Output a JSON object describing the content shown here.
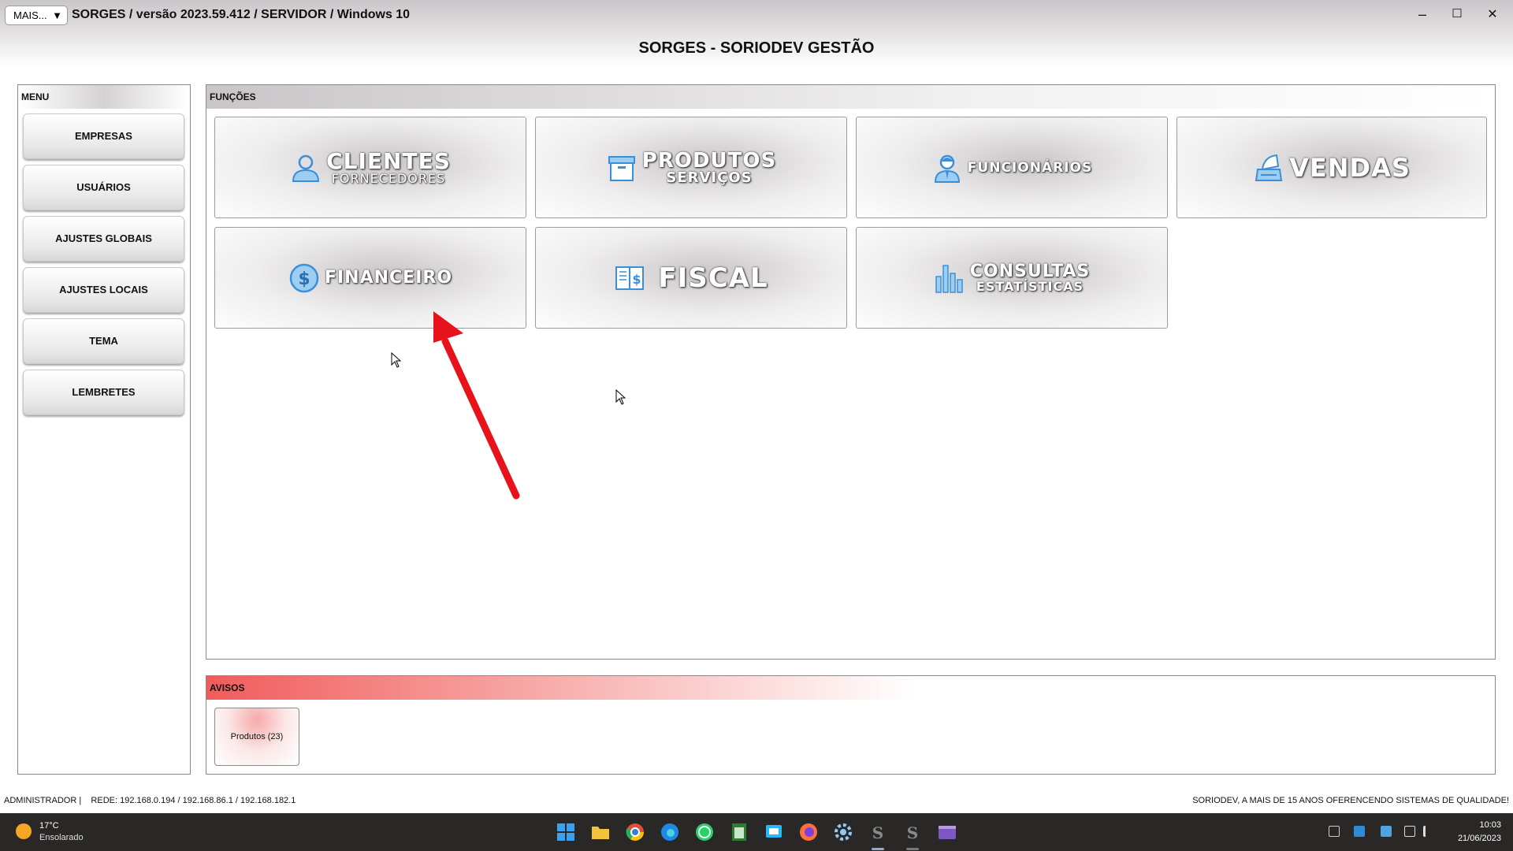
{
  "window": {
    "mais_label": "MAIS...",
    "mais_caret": "▼",
    "title": "SORGES / versão 2023.59.412 / SERVIDOR / Windows 10",
    "minimize_glyph": "–",
    "maximize_glyph": "☐",
    "close_glyph": "✕"
  },
  "app_title": "SORGES - SORIODEV GESTÃO",
  "menu": {
    "header": "MENU",
    "items": [
      "EMPRESAS",
      "USUÁRIOS",
      "AJUSTES GLOBAIS",
      "AJUSTES LOCAIS",
      "TEMA",
      "LEMBRETES"
    ]
  },
  "funcoes": {
    "header": "FUNÇÕES",
    "tiles": [
      {
        "main": "CLIENTES",
        "sub": "FORNECEDORES",
        "icon": "person-icon"
      },
      {
        "main": "PRODUTOS",
        "sub": "SERVIÇOS",
        "icon": "box-icon"
      },
      {
        "main": "FUNCIONÁRIOS",
        "sub": "",
        "icon": "employee-icon"
      },
      {
        "main": "VENDAS",
        "sub": "",
        "icon": "cash-register-icon"
      },
      {
        "main": "FINANCEIRO",
        "sub": "",
        "icon": "dollar-coin-icon"
      },
      {
        "main": "FISCAL",
        "sub": "",
        "icon": "fiscal-book-icon"
      },
      {
        "main": "CONSULTAS",
        "sub": "ESTATÍSTICAS",
        "icon": "bar-chart-icon"
      }
    ]
  },
  "avisos": {
    "header": "AVISOS",
    "items": [
      "Produtos (23)"
    ]
  },
  "status": {
    "left": "ADMINISTRADOR |    REDE: 192.168.0.194 / 192.168.86.1 / 192.168.182.1",
    "right": "SORIODEV, A MAIS DE 15 ANOS OFERENCENDO SISTEMAS DE QUALIDADE!"
  },
  "taskbar": {
    "temperature": "17°C",
    "weather": "Ensolarado",
    "time": "10:03",
    "date": "21/06/2023"
  },
  "colors": {
    "accent_blue": "#3b8fd9",
    "arrow_red": "#e8121b",
    "avisos_red": "#f15b5b"
  }
}
